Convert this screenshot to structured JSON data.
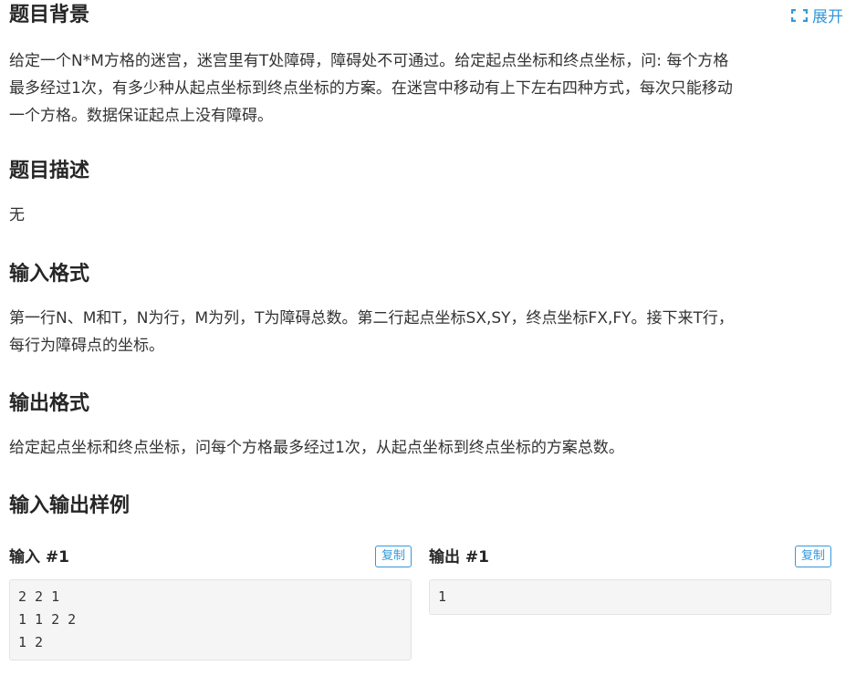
{
  "expand": {
    "label": "展开"
  },
  "background": {
    "title": "题目背景",
    "lines": [
      "给定一个N*M方格的迷宫，迷宫里有T处障碍，障碍处不可通过。给定起点坐标和终点坐标，问: 每个方格",
      "最多经过1次，有多少种从起点坐标到终点坐标的方案。在迷宫中移动有上下左右四种方式，每次只能移动",
      "一个方格。数据保证起点上没有障碍。"
    ]
  },
  "description": {
    "title": "题目描述",
    "text": "无"
  },
  "input_format": {
    "title": "输入格式",
    "lines": [
      "第一行N、M和T，N为行，M为列，T为障碍总数。第二行起点坐标SX,SY，终点坐标FX,FY。接下来T行，",
      "每行为障碍点的坐标。"
    ]
  },
  "output_format": {
    "title": "输出格式",
    "text": "给定起点坐标和终点坐标，问每个方格最多经过1次，从起点坐标到终点坐标的方案总数。"
  },
  "samples": {
    "title": "输入输出样例",
    "input": {
      "label": "输入 #1",
      "copy_label": "复制",
      "content": "2 2 1\n1 1 2 2\n1 2"
    },
    "output": {
      "label": "输出 #1",
      "copy_label": "复制",
      "content": "1"
    }
  }
}
